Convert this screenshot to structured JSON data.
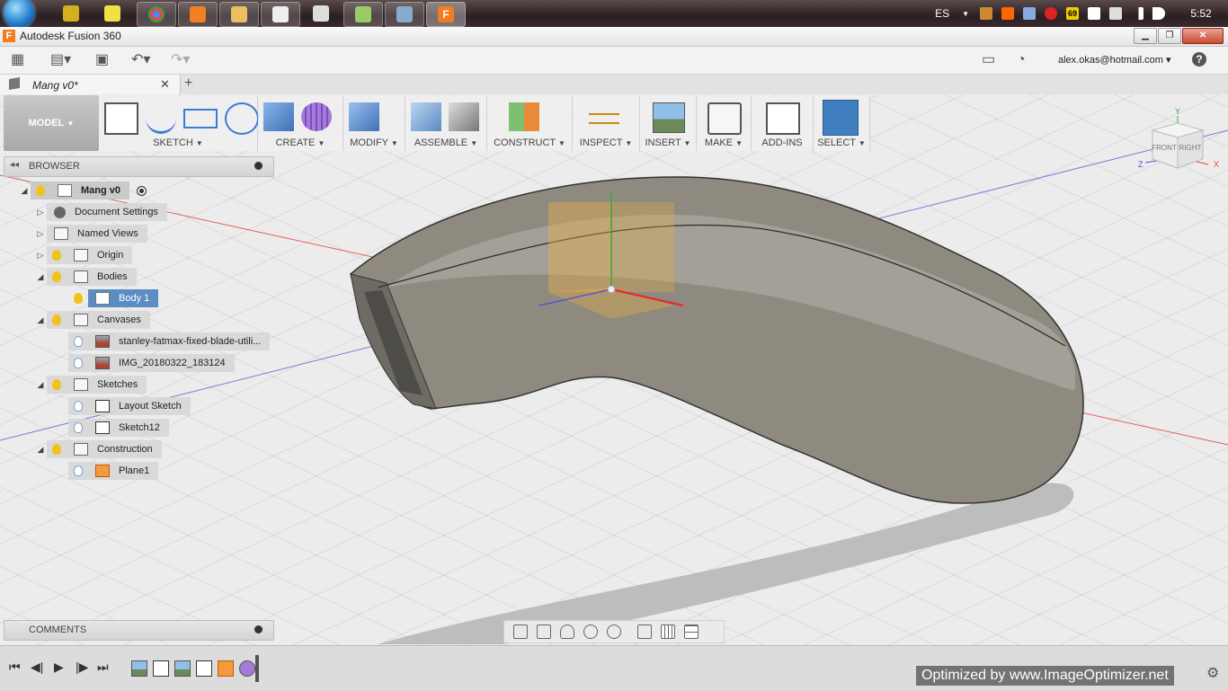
{
  "taskbar": {
    "language": "ES",
    "clock": "5:52",
    "apps": [
      "winamp-icon",
      "notepad-icon",
      "chrome-icon",
      "media-player-icon",
      "explorer-icon",
      "app-icon",
      "calculator-icon",
      "messenger-icon",
      "remote-desktop-icon",
      "fusion-icon"
    ],
    "tray_badge": "69"
  },
  "window": {
    "title": "Autodesk Fusion 360",
    "app_letter": "F"
  },
  "qat": {
    "user": "alex.okas@hotmail.com",
    "user_caret": "▾",
    "help": "?"
  },
  "document": {
    "tab_name": "Mang v0*",
    "close": "✕",
    "new_tab": "+"
  },
  "ribbon": {
    "workspace": "MODEL",
    "groups": [
      "SKETCH",
      "CREATE",
      "MODIFY",
      "ASSEMBLE",
      "CONSTRUCT",
      "INSPECT",
      "INSERT",
      "MAKE",
      "ADD-INS",
      "SELECT"
    ]
  },
  "browser": {
    "title": "BROWSER",
    "root": "Mang v0",
    "items": [
      {
        "label": "Document Settings"
      },
      {
        "label": "Named Views"
      },
      {
        "label": "Origin"
      },
      {
        "label": "Bodies"
      },
      {
        "label": "Body 1"
      },
      {
        "label": "Canvases"
      },
      {
        "label": "stanley-fatmax-fixed-blade-utili..."
      },
      {
        "label": "IMG_20180322_183124"
      },
      {
        "label": "Sketches"
      },
      {
        "label": "Layout Sketch"
      },
      {
        "label": "Sketch12"
      },
      {
        "label": "Construction"
      },
      {
        "label": "Plane1"
      }
    ]
  },
  "comments": {
    "title": "COMMENTS"
  },
  "viewcube": {
    "front": "FRONT",
    "right": "RIGHT",
    "axis_x": "X",
    "axis_y": "Y",
    "axis_z": "Z"
  },
  "watermark": "Optimized by www.ImageOptimizer.net",
  "colors": {
    "accent": "#f47b20",
    "selection": "#5b8cc4",
    "select_button": "#3f7fbf"
  }
}
